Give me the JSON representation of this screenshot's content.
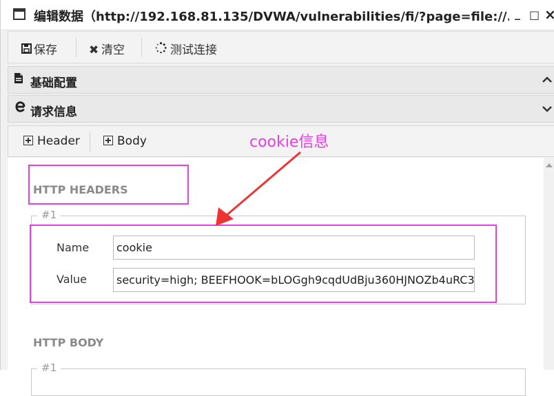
{
  "window": {
    "title": "编辑数据（http://192.168.81.135/DVWA/vulnerabilities/fi/?page=file://...",
    "minimize_glyph": "_",
    "maximize_glyph": "□",
    "close_glyph": "×"
  },
  "toolbar": {
    "save_label": "保存",
    "clear_label": "清空",
    "test_label": "测试连接"
  },
  "panels": {
    "basic_config_label": "基础配置",
    "request_info_label": "请求信息"
  },
  "tabs": {
    "header_label": "Header",
    "body_label": "Body"
  },
  "headers_section": {
    "title": "HTTP HEADERS",
    "entries": [
      {
        "legend": "#1",
        "name_label": "Name",
        "name_value": "cookie",
        "value_label": "Value",
        "value_value": "security=high; BEEFHOOK=bLOGgh9cqdUdBju360HJNOZb4uRC3"
      }
    ]
  },
  "body_section": {
    "title": "HTTP BODY",
    "entries": [
      {
        "legend": "#1"
      }
    ]
  },
  "annotation": {
    "text": "cookie信息",
    "color": "#e33fe3"
  },
  "icons": {
    "window": "window-icon",
    "save": "save-icon",
    "clear": "close-x-icon",
    "test": "spinner-icon",
    "document": "document-icon",
    "ie": "ie-icon",
    "chevron_up": "chevron-up-icon",
    "chevron_down": "chevron-down-icon",
    "plus_box": "plus-square-icon"
  }
}
